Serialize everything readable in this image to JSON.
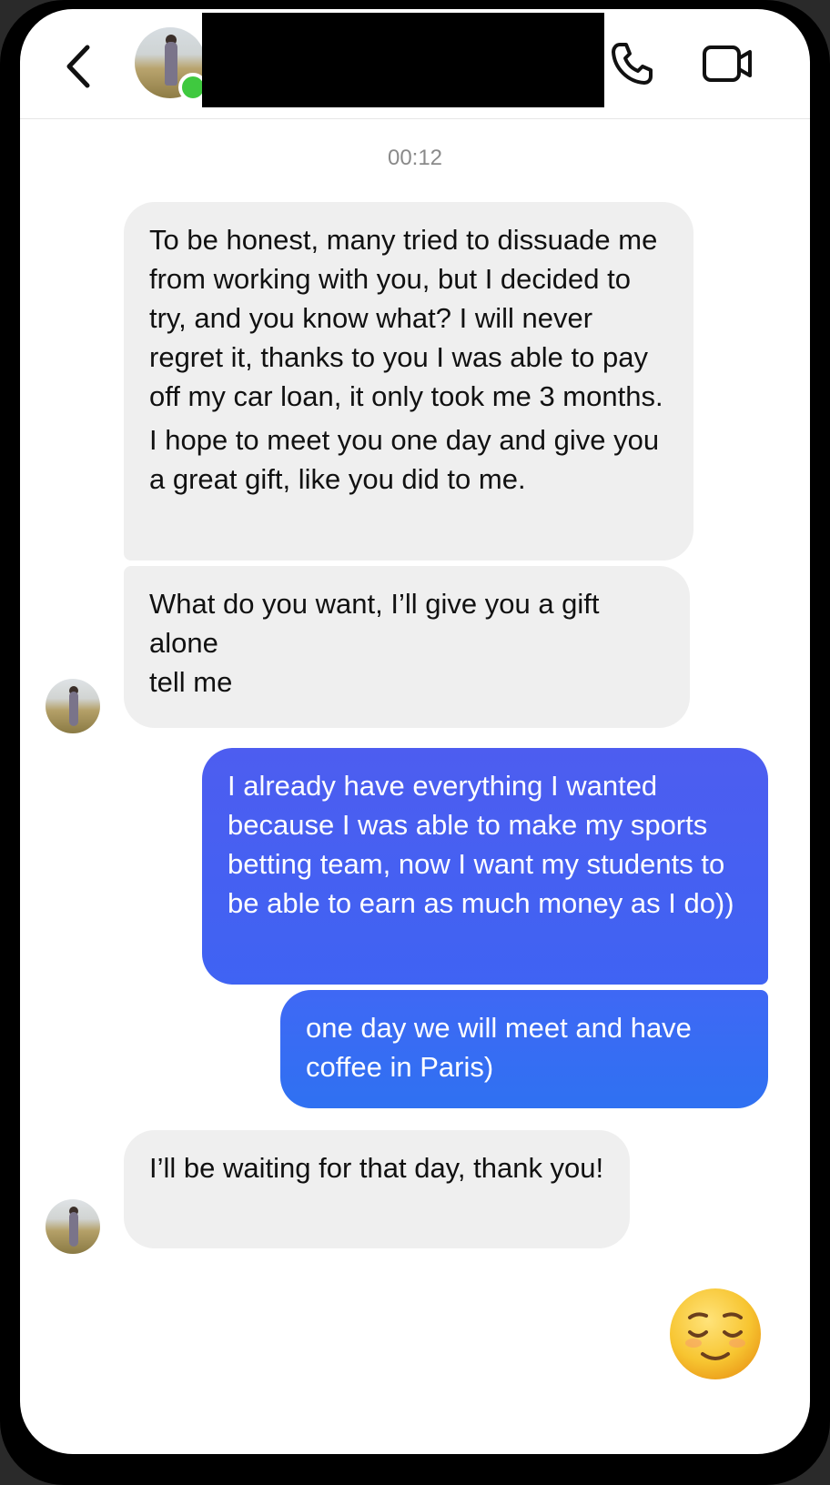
{
  "header": {
    "back_icon": "chevron-left-icon",
    "contact_status": "online",
    "call_icon": "phone-icon",
    "video_icon": "video-camera-icon"
  },
  "timestamp": "00:12",
  "messages": [
    {
      "sender": "contact",
      "paragraphs": [
        "To be honest, many tried to dissuade me from working with you, but I decided to try, and you know what? I will never regret it, thanks to you I was able to pay off my car loan, it only took me 3 months.",
        "I hope to meet you one day and give you a great gift, like you did to me."
      ]
    },
    {
      "sender": "contact",
      "paragraphs": [
        "What do you want, I’ll give you a gift alone",
        "tell me"
      ]
    },
    {
      "sender": "me",
      "paragraphs": [
        "I already have everything I wanted because I was able to make my sports betting team, now I want my students to be able to earn as much money as I do))"
      ]
    },
    {
      "sender": "me",
      "paragraphs": [
        "one day we will meet and have coffee in Paris)"
      ]
    },
    {
      "sender": "contact",
      "paragraphs": [
        "I’ll be waiting for that day, thank you!"
      ]
    }
  ],
  "quick_reaction": {
    "icon": "relieved-face-emoji-icon"
  },
  "colors": {
    "incoming_bubble": "#efefef",
    "outgoing_bubble": "#4562f2",
    "online": "#3fc93f"
  }
}
